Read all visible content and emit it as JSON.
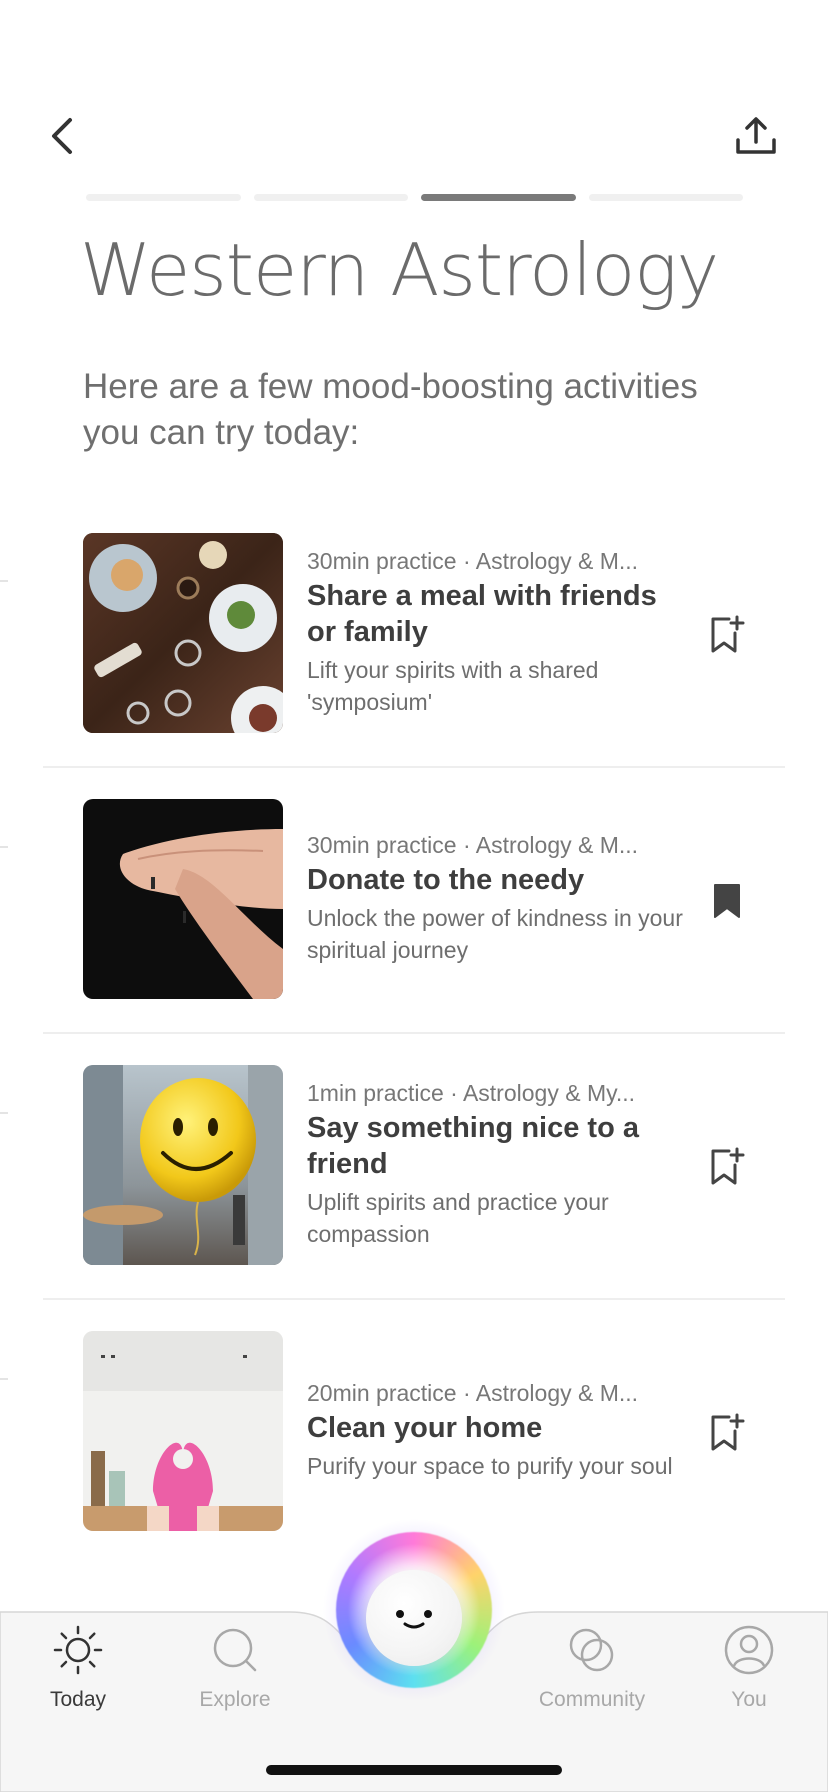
{
  "header": {
    "back_icon": "chevron-left-icon",
    "share_icon": "share-upload-icon"
  },
  "progress": {
    "total": 4,
    "current": 3
  },
  "page": {
    "title": "Western Astrology",
    "subtitle": "Here are a few mood-boosting activities you can try today:"
  },
  "activities": [
    {
      "meta": "30min practice · Astrology & M...",
      "title": "Share a meal with friends or family",
      "description": "Lift your spirits with a shared 'symposium'",
      "bookmarked": false,
      "image": "dinner-table-photo"
    },
    {
      "meta": "30min practice · Astrology & M...",
      "title": "Donate to the needy",
      "description": "Unlock the power of kindness in your spiritual journey",
      "bookmarked": true,
      "image": "hands-photo"
    },
    {
      "meta": "1min practice · Astrology & My...",
      "title": "Say something nice to a friend",
      "description": "Uplift spirits and practice your compassion",
      "bookmarked": false,
      "image": "smiley-balloon-photo"
    },
    {
      "meta": "20min practice · Astrology & M...",
      "title": "Clean your home",
      "description": "Purify your space to purify your soul",
      "bookmarked": false,
      "image": "heart-hands-kitchen-photo"
    }
  ],
  "tabbar": {
    "items": [
      {
        "label": "Today",
        "icon": "sun-icon",
        "active": true
      },
      {
        "label": "Explore",
        "icon": "search-icon",
        "active": false
      },
      {
        "label": "Community",
        "icon": "community-circles-icon",
        "active": false
      },
      {
        "label": "You",
        "icon": "user-icon",
        "active": false
      }
    ],
    "center_icon": "smiley-orb-icon"
  },
  "colors": {
    "text_primary": "#3e3e3e",
    "text_secondary": "#777777",
    "progress_active": "#7a7a7a",
    "progress_inactive": "#f0f0f0",
    "tab_inactive": "#a8a8a8"
  }
}
